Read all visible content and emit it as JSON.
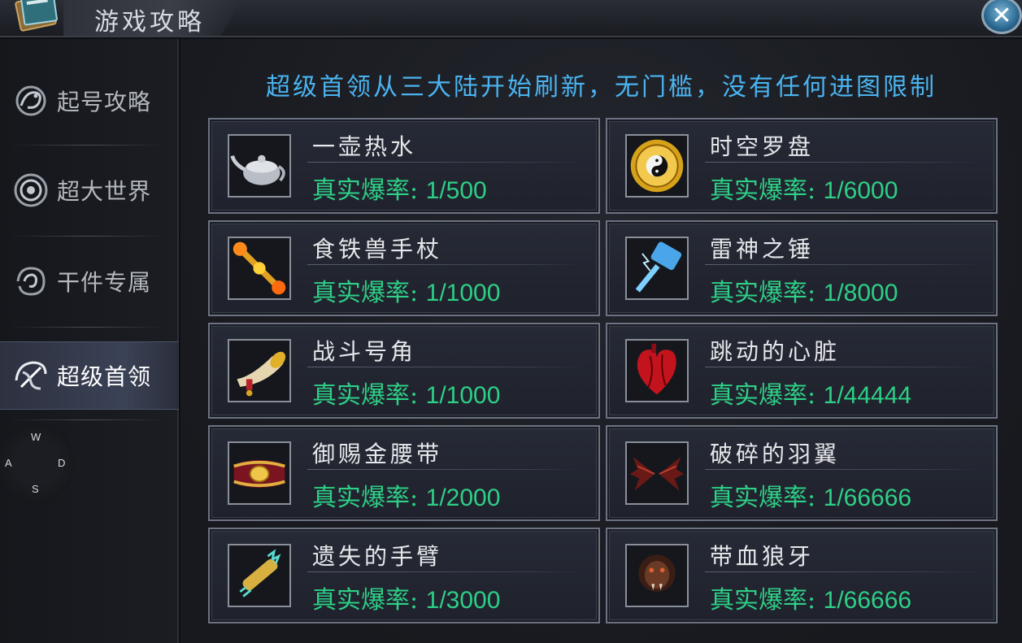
{
  "window": {
    "title": "游戏攻略",
    "close_symbol": "✕",
    "icon": "book-icon"
  },
  "sidebar": {
    "items": [
      {
        "label": "起号攻略",
        "icon": "dragon-emblem-icon",
        "active": false
      },
      {
        "label": "超大世界",
        "icon": "swirl-emblem-icon",
        "active": false
      },
      {
        "label": "干件专属",
        "icon": "tribal-emblem-icon",
        "active": false
      },
      {
        "label": "超级首领",
        "icon": "boss-emblem-icon",
        "active": true
      }
    ]
  },
  "wasd": {
    "w": "W",
    "a": "A",
    "s": "S",
    "d": "D"
  },
  "main": {
    "headline": "超级首领从三大陆开始刷新，无门槛，没有任何进图限制",
    "rate_label": "真实爆率: ",
    "items": [
      {
        "name": "一壶热水",
        "rate": "1/500",
        "icon": "teapot-icon"
      },
      {
        "name": "时空罗盘",
        "rate": "1/6000",
        "icon": "yin-yang-compass-icon"
      },
      {
        "name": "食铁兽手杖",
        "rate": "1/1000",
        "icon": "flaming-staff-icon"
      },
      {
        "name": "雷神之锤",
        "rate": "1/8000",
        "icon": "lightning-hammer-icon"
      },
      {
        "name": "战斗号角",
        "rate": "1/1000",
        "icon": "war-horn-icon"
      },
      {
        "name": "跳动的心脏",
        "rate": "1/44444",
        "icon": "beating-heart-icon"
      },
      {
        "name": "御赐金腰带",
        "rate": "1/2000",
        "icon": "golden-belt-icon"
      },
      {
        "name": "破碎的羽翼",
        "rate": "1/66666",
        "icon": "broken-wings-icon"
      },
      {
        "name": "遗失的手臂",
        "rate": "1/3000",
        "icon": "lost-arm-icon"
      },
      {
        "name": "带血狼牙",
        "rate": "1/66666",
        "icon": "bloody-fang-icon"
      }
    ]
  },
  "colors": {
    "headline": "#4ab4f0",
    "rate": "#2ecf86",
    "active_tab": "#3b4256"
  }
}
